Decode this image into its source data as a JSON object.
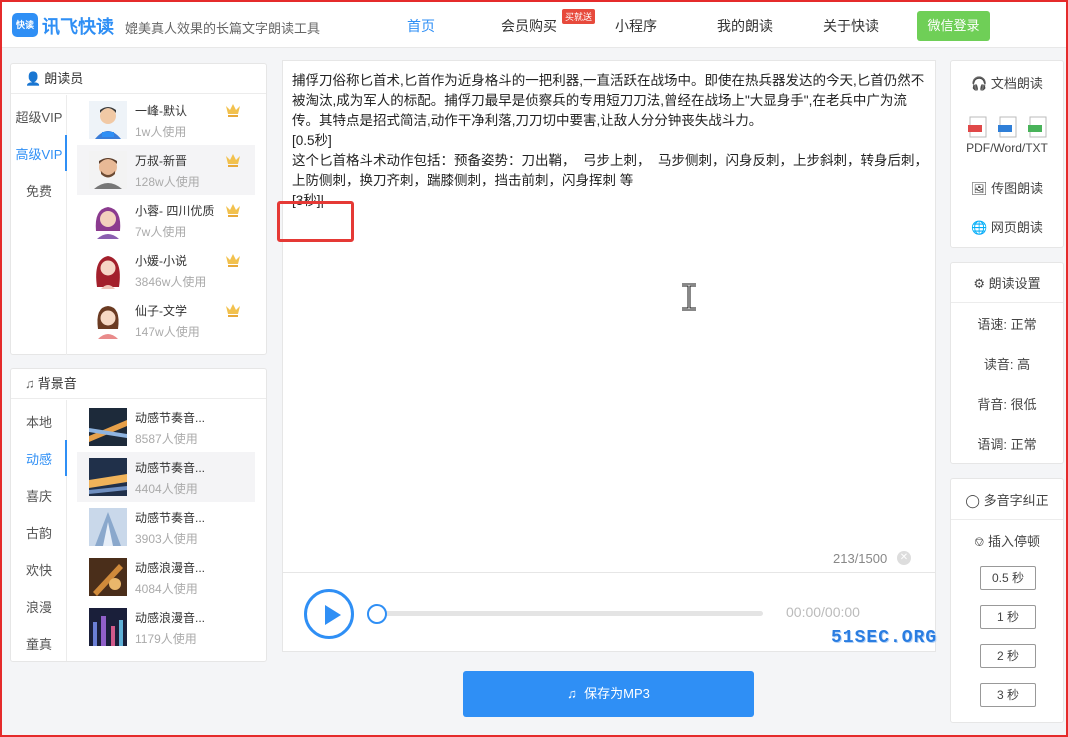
{
  "header": {
    "logo_mark": "快读",
    "app_name": "讯飞快读",
    "slogan": "媲美真人效果的长篇文字朗读工具",
    "nav": [
      "首页",
      "会员购买",
      "小程序",
      "我的朗读",
      "关于快读"
    ],
    "nav_badge": "买就送",
    "login": "微信登录"
  },
  "readers": {
    "title": "朗读员",
    "tabs": [
      "超级VIP",
      "高级VIP",
      "免费"
    ],
    "active_tab": "高级VIP",
    "items": [
      {
        "name": "一峰-默认",
        "usage": "1w人使用"
      },
      {
        "name": "万叔-新晋",
        "usage": "128w人使用"
      },
      {
        "name": "小蓉- 四川优质",
        "usage": "7w人使用"
      },
      {
        "name": "小媛-小说",
        "usage": "3846w人使用"
      },
      {
        "name": "仙子-文学",
        "usage": "147w人使用"
      }
    ]
  },
  "bgm": {
    "title": "背景音",
    "tabs": [
      "本地",
      "动感",
      "喜庆",
      "古韵",
      "欢快",
      "浪漫",
      "童真"
    ],
    "active_tab": "动感",
    "items": [
      {
        "name": "动感节奏音...",
        "usage": "8587人使用"
      },
      {
        "name": "动感节奏音...",
        "usage": "4404人使用"
      },
      {
        "name": "动感节奏音...",
        "usage": "3903人使用"
      },
      {
        "name": "动感浪漫音...",
        "usage": "4084人使用"
      },
      {
        "name": "动感浪漫音...",
        "usage": "1179人使用"
      }
    ]
  },
  "editor": {
    "text": "捕俘刀俗称匕首术,匕首作为近身格斗的一把利器,一直活跃在战场中。即使在热兵器发达的今天,匕首仍然不被淘汰,成为军人的标配。捕俘刀最早是侦察兵的专用短刀刀法,曾经在战场上\"大显身手\",在老兵中广为流传。其特点是招式简洁,动作干净利落,刀刀切中要害,让敌人分分钟丧失战斗力。\n[0.5秒]\n这个匕首格斗术动作包括：预备姿势：刀出鞘，  弓步上刺，  马步侧刺，闪身反刺，上步斜刺，转身后刺，  上防侧刺，换刀齐刺，踹膝侧刺，挡击前刺，闪身挥刺 等\n[3秒]|",
    "counter": "213/1500"
  },
  "player": {
    "time": "00:00/00:00",
    "progress": 0
  },
  "watermark": "51SEC.ORG",
  "save_button": "保存为MP3",
  "doc_reading": {
    "title": "文档朗读",
    "formats": "PDF/Word/TXT",
    "image_reading": "传图朗读",
    "web_reading": "网页朗读"
  },
  "settings": {
    "title": "朗读设置",
    "speed": "语速: 正常",
    "pitch": "读音: 高",
    "bg_volume": "背音: 很低",
    "tone": "语调: 正常"
  },
  "polyphone": {
    "title": "多音字纠正",
    "insert_pause": "插入停顿",
    "pauses": [
      "0.5 秒",
      "1 秒",
      "2 秒",
      "3 秒"
    ]
  },
  "colors": {
    "accent": "#2f8ff5",
    "login": "#6fcf57",
    "highlight": "#e53935"
  }
}
